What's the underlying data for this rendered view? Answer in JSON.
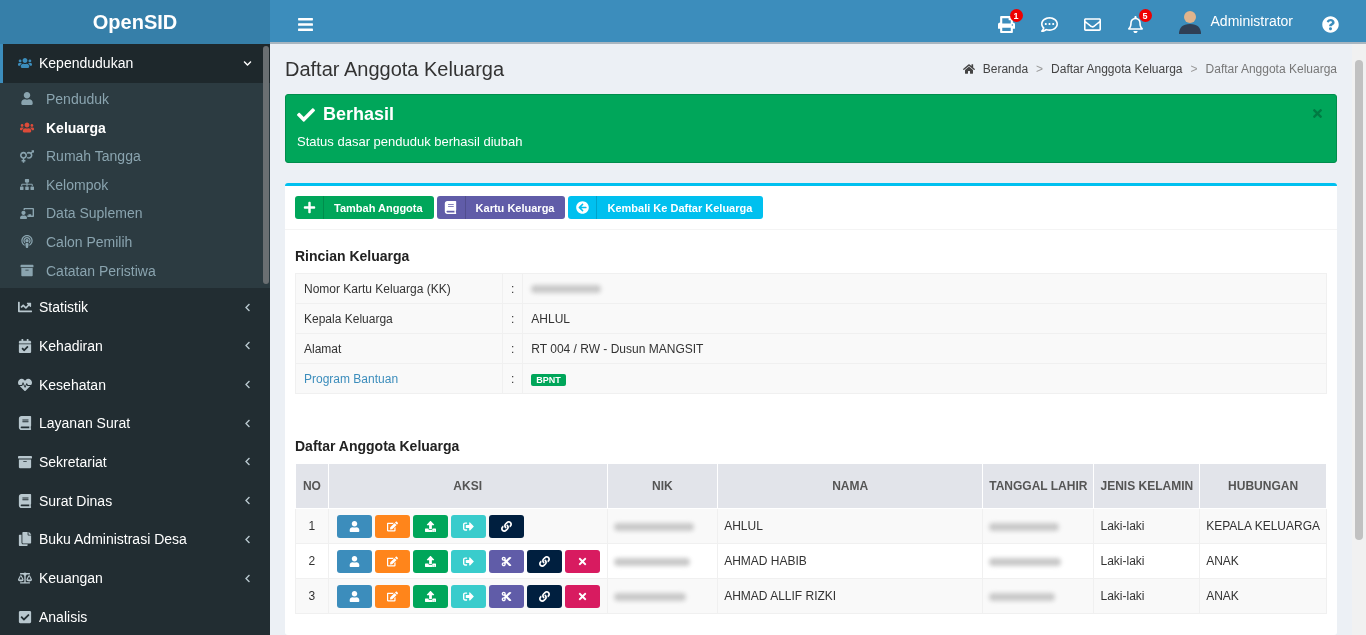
{
  "brand": "OpenSID",
  "header": {
    "print_badge": "1",
    "notification_badge": "5",
    "user": "Administrator"
  },
  "sidebar": {
    "items": [
      {
        "label": "Kependudukan",
        "kind": "menu",
        "expanded": true,
        "children": [
          {
            "label": "Penduduk",
            "selected": false
          },
          {
            "label": "Keluarga",
            "selected": true
          },
          {
            "label": "Rumah Tangga",
            "selected": false
          },
          {
            "label": "Kelompok",
            "selected": false
          },
          {
            "label": "Data Suplemen",
            "selected": false
          },
          {
            "label": "Calon Pemilih",
            "selected": false
          },
          {
            "label": "Catatan Peristiwa",
            "selected": false
          }
        ]
      },
      {
        "label": "Statistik",
        "kind": "menu",
        "expanded": false
      },
      {
        "label": "Kehadiran",
        "kind": "menu",
        "expanded": false
      },
      {
        "label": "Kesehatan",
        "kind": "menu",
        "expanded": false
      },
      {
        "label": "Layanan Surat",
        "kind": "menu",
        "expanded": false
      },
      {
        "label": "Sekretariat",
        "kind": "menu",
        "expanded": false
      },
      {
        "label": "Surat Dinas",
        "kind": "menu",
        "expanded": false
      },
      {
        "label": "Buku Administrasi Desa",
        "kind": "menu",
        "expanded": false
      },
      {
        "label": "Keuangan",
        "kind": "menu",
        "expanded": false
      },
      {
        "label": "Analisis",
        "kind": "link",
        "expanded": false
      }
    ]
  },
  "page_title": "Daftar Anggota Keluarga",
  "breadcrumb": [
    {
      "label": "Beranda"
    },
    {
      "separator": ">",
      "label": "Daftar Anggota Keluarga"
    },
    {
      "separator": ">",
      "label": "Daftar Anggota Keluarga"
    }
  ],
  "alert": {
    "title": "Berhasil",
    "message": "Status dasar penduduk berhasil diubah"
  },
  "toolbar": [
    {
      "label": "Tambah Anggota",
      "kind": "add"
    },
    {
      "label": "Kartu Keluarga",
      "kind": "card"
    },
    {
      "label": "Kembali Ke Daftar Keluarga",
      "kind": "back"
    }
  ],
  "details": {
    "title": "Rincian Keluarga",
    "rows": [
      {
        "label": "Nomor Kartu Keluarga (KK)",
        "separator": ":",
        "kind": "hidden",
        "link": false
      },
      {
        "label": "Kepala Keluarga",
        "separator": ":",
        "kind": "text",
        "link": false,
        "value": "AHLUL"
      },
      {
        "label": "Alamat",
        "separator": ":",
        "kind": "text",
        "link": false,
        "value": "RT 004 / RW - Dusun MANGSIT"
      },
      {
        "label": "Program Bantuan",
        "separator": ":",
        "kind": "badge",
        "link": true,
        "value": "BPNT"
      }
    ]
  },
  "members": {
    "title": "Daftar Anggota Keluarga",
    "columns": [
      "NO",
      "AKSI",
      "NIK",
      "NAMA",
      "TANGGAL LAHIR",
      "JENIS KELAMIN",
      "HUBUNGAN"
    ],
    "rows": [
      {
        "no": "1",
        "actions": [
          {
            "kind": "view"
          },
          {
            "kind": "edit"
          },
          {
            "kind": "upload"
          },
          {
            "kind": "move"
          },
          {
            "kind": "link"
          }
        ],
        "nama": "AHLUL",
        "jenis_kelamin": "Laki-laki",
        "hubungan": "KEPALA KELUARGA"
      },
      {
        "no": "2",
        "actions": [
          {
            "kind": "view"
          },
          {
            "kind": "edit"
          },
          {
            "kind": "upload"
          },
          {
            "kind": "move"
          },
          {
            "kind": "split"
          },
          {
            "kind": "link"
          },
          {
            "kind": "delete"
          }
        ],
        "nama": "AHMAD HABIB",
        "jenis_kelamin": "Laki-laki",
        "hubungan": "ANAK"
      },
      {
        "no": "3",
        "actions": [
          {
            "kind": "view"
          },
          {
            "kind": "edit"
          },
          {
            "kind": "upload"
          },
          {
            "kind": "move"
          },
          {
            "kind": "split"
          },
          {
            "kind": "link"
          },
          {
            "kind": "delete"
          }
        ],
        "nama": "AHMAD ALLIF RIZKI",
        "jenis_kelamin": "Laki-laki",
        "hubungan": "ANAK"
      }
    ]
  }
}
